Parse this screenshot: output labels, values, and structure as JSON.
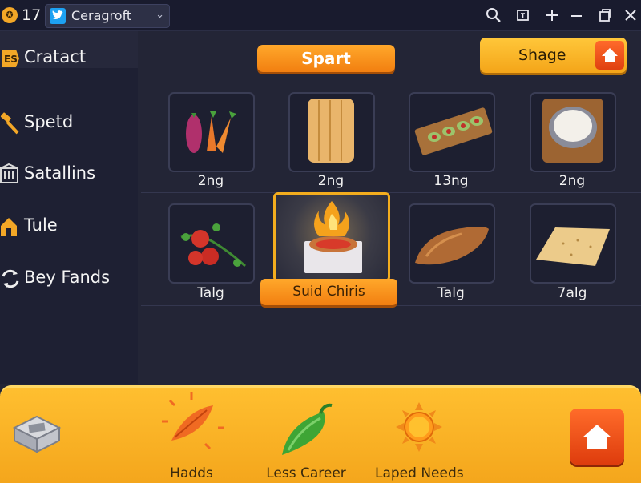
{
  "titlebar": {
    "app_badge_icon": "game-controller-icon",
    "count": "17",
    "account_select": {
      "icon": "twitter-bird-icon",
      "value": "Ceragroft"
    },
    "buttons": [
      "search-icon",
      "tile-icon",
      "plus-icon",
      "minimize-icon",
      "restore-icon",
      "close-icon"
    ]
  },
  "sidebar": {
    "header": {
      "label": "Cratact",
      "icon": "badge-icon"
    },
    "items": [
      {
        "label": "Spetd",
        "icon": "hammer-icon"
      },
      {
        "label": "Satallins",
        "icon": "building-icon"
      },
      {
        "label": "Tule",
        "icon": "house-icon"
      },
      {
        "label": "Bey Fands",
        "icon": "sync-icon"
      }
    ]
  },
  "main": {
    "spart_label": "Spart",
    "shage_label": "Shage",
    "grid": [
      {
        "caption": "2ng",
        "icon": "vegetables-icon"
      },
      {
        "caption": "2ng",
        "icon": "bread-icon"
      },
      {
        "caption": "13ng",
        "icon": "canapes-icon"
      },
      {
        "caption": "2ng",
        "icon": "dip-bowl-icon"
      },
      {
        "caption": "Talg",
        "icon": "tomatoes-icon"
      },
      {
        "caption": "Suid Chiris",
        "icon": "cooking-pot-icon",
        "selected": true
      },
      {
        "caption": "Talg",
        "icon": "loaf-icon"
      },
      {
        "caption": "7alg",
        "icon": "cracker-icon"
      }
    ]
  },
  "bottom_nav": {
    "items": [
      {
        "label": "",
        "icon": "box-icon"
      },
      {
        "label": "Hadds",
        "icon": "spice-leaf-icon"
      },
      {
        "label": "Less Career",
        "icon": "pepper-icon"
      },
      {
        "label": "Laped Needs",
        "icon": "sun-icon"
      }
    ],
    "home_icon": "home-icon"
  },
  "colors": {
    "background": "#232536",
    "sidebar": "#1e2033",
    "accent_orange": "#f28a16",
    "bottom_bar": "#f7b026",
    "selected_border": "#f3ad1e"
  }
}
